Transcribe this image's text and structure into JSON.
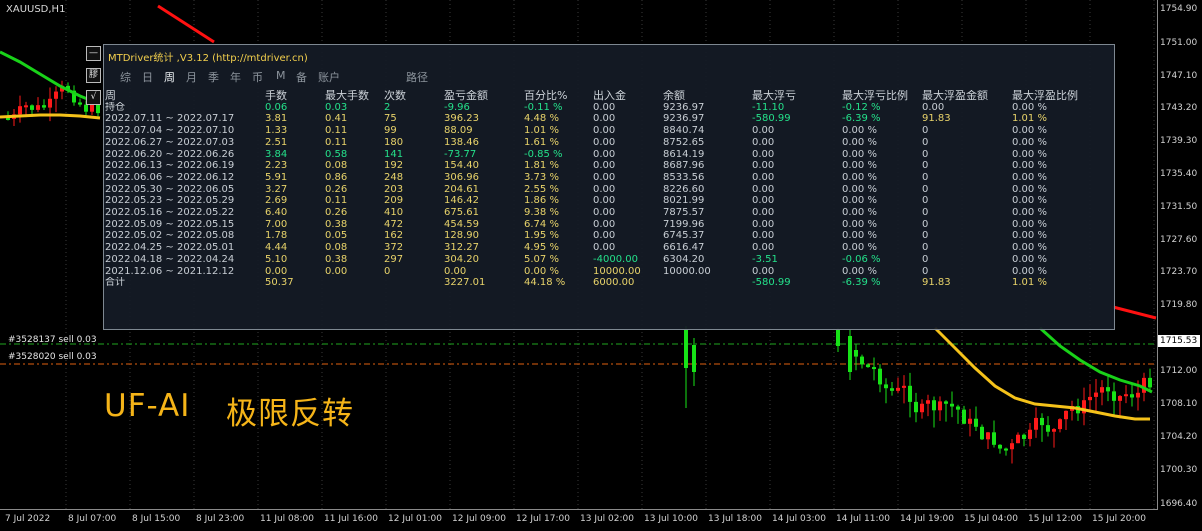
{
  "chart": {
    "symbol": "XAUUSD,H1",
    "price_labels": [
      "1754.90",
      "1751.00",
      "1747.10",
      "1743.20",
      "1739.30",
      "1735.40",
      "1731.50",
      "1727.60",
      "1723.70",
      "1719.80",
      "1715.53",
      "1712.00",
      "1708.10",
      "1704.20",
      "1700.30",
      "1696.40"
    ],
    "current_price": "1715.53",
    "time_labels": [
      "7 Jul 2022",
      "8 Jul 07:00",
      "8 Jul 15:00",
      "8 Jul 23:00",
      "11 Jul 08:00",
      "11 Jul 16:00",
      "12 Jul 01:00",
      "12 Jul 09:00",
      "12 Jul 17:00",
      "13 Jul 02:00",
      "13 Jul 10:00",
      "13 Jul 18:00",
      "14 Jul 03:00",
      "14 Jul 11:00",
      "14 Jul 19:00",
      "15 Jul 04:00",
      "15 Jul 12:00",
      "15 Jul 20:00"
    ],
    "orders": [
      "#3528137 sell 0.03",
      "#3528020 sell 0.03"
    ],
    "overlay_text_left": "UF-AI",
    "overlay_text_right": "极限反转",
    "colors": {
      "bull": "#ff1a1a",
      "bear": "#17e317",
      "ma_green": "#19d219",
      "ma_yellow": "#f5c21a",
      "red_line": "#ff1111"
    }
  },
  "mini_buttons": [
    "—",
    "膠",
    "√"
  ],
  "panel": {
    "title": "MTDriver统计 ,V3.12 (http://mtdriver.cn)",
    "tabs": [
      "综",
      "日",
      "周",
      "月",
      "季",
      "年",
      "币",
      "M",
      "备",
      "账户",
      "路径"
    ],
    "active_tab": "周",
    "columns": [
      "周",
      "手数",
      "最大手数",
      "次数",
      "盈亏金额",
      "百分比%",
      "出入金",
      "余额",
      "最大浮亏",
      "最大浮亏比例",
      "最大浮盈金额",
      "最大浮盈比例"
    ],
    "hold_row": [
      "持仓",
      "0.06",
      "0.03",
      "2",
      "-9.96",
      "-0.11 %",
      "0.00",
      "9236.97",
      "-11.10",
      "-0.12 %",
      "0.00",
      "0.00 %"
    ],
    "rows": [
      [
        "2022.07.11 ~ 2022.07.17",
        "3.81",
        "0.41",
        "75",
        "396.23",
        "4.48 %",
        "0.00",
        "9236.97",
        "-580.99",
        "-6.39 %",
        "91.83",
        "1.01 %"
      ],
      [
        "2022.07.04 ~ 2022.07.10",
        "1.33",
        "0.11",
        "99",
        "88.09",
        "1.01 %",
        "0.00",
        "8840.74",
        "0.00",
        "0.00 %",
        "0",
        "0.00 %"
      ],
      [
        "2022.06.27 ~ 2022.07.03",
        "2.51",
        "0.11",
        "180",
        "138.46",
        "1.61 %",
        "0.00",
        "8752.65",
        "0.00",
        "0.00 %",
        "0",
        "0.00 %"
      ],
      [
        "2022.06.20 ~ 2022.06.26",
        "3.84",
        "0.58",
        "141",
        "-73.77",
        "-0.85 %",
        "0.00",
        "8614.19",
        "0.00",
        "0.00 %",
        "0",
        "0.00 %"
      ],
      [
        "2022.06.13 ~ 2022.06.19",
        "2.23",
        "0.08",
        "192",
        "154.40",
        "1.81 %",
        "0.00",
        "8687.96",
        "0.00",
        "0.00 %",
        "0",
        "0.00 %"
      ],
      [
        "2022.06.06 ~ 2022.06.12",
        "5.91",
        "0.86",
        "248",
        "306.96",
        "3.73 %",
        "0.00",
        "8533.56",
        "0.00",
        "0.00 %",
        "0",
        "0.00 %"
      ],
      [
        "2022.05.30 ~ 2022.06.05",
        "3.27",
        "0.26",
        "203",
        "204.61",
        "2.55 %",
        "0.00",
        "8226.60",
        "0.00",
        "0.00 %",
        "0",
        "0.00 %"
      ],
      [
        "2022.05.23 ~ 2022.05.29",
        "2.69",
        "0.11",
        "209",
        "146.42",
        "1.86 %",
        "0.00",
        "8021.99",
        "0.00",
        "0.00 %",
        "0",
        "0.00 %"
      ],
      [
        "2022.05.16 ~ 2022.05.22",
        "6.40",
        "0.26",
        "410",
        "675.61",
        "9.38 %",
        "0.00",
        "7875.57",
        "0.00",
        "0.00 %",
        "0",
        "0.00 %"
      ],
      [
        "2022.05.09 ~ 2022.05.15",
        "7.00",
        "0.38",
        "472",
        "454.59",
        "6.74 %",
        "0.00",
        "7199.96",
        "0.00",
        "0.00 %",
        "0",
        "0.00 %"
      ],
      [
        "2022.05.02 ~ 2022.05.08",
        "1.78",
        "0.05",
        "162",
        "128.90",
        "1.95 %",
        "0.00",
        "6745.37",
        "0.00",
        "0.00 %",
        "0",
        "0.00 %"
      ],
      [
        "2022.04.25 ~ 2022.05.01",
        "4.44",
        "0.08",
        "372",
        "312.27",
        "4.95 %",
        "0.00",
        "6616.47",
        "0.00",
        "0.00 %",
        "0",
        "0.00 %"
      ],
      [
        "2022.04.18 ~ 2022.04.24",
        "5.10",
        "0.38",
        "297",
        "304.20",
        "5.07 %",
        "-4000.00",
        "6304.20",
        "-3.51",
        "-0.06 %",
        "0",
        "0.00 %"
      ],
      [
        "2021.12.06 ~ 2021.12.12",
        "0.00",
        "0.00",
        "0",
        "0.00",
        "0.00 %",
        "10000.00",
        "10000.00",
        "0.00",
        "0.00 %",
        "0",
        "0.00 %"
      ]
    ],
    "total_row": [
      "合计",
      "50.37",
      "",
      "",
      "3227.01",
      "44.18 %",
      "6000.00",
      "",
      "-580.99",
      "-6.39 %",
      "91.83",
      "1.01 %"
    ]
  }
}
